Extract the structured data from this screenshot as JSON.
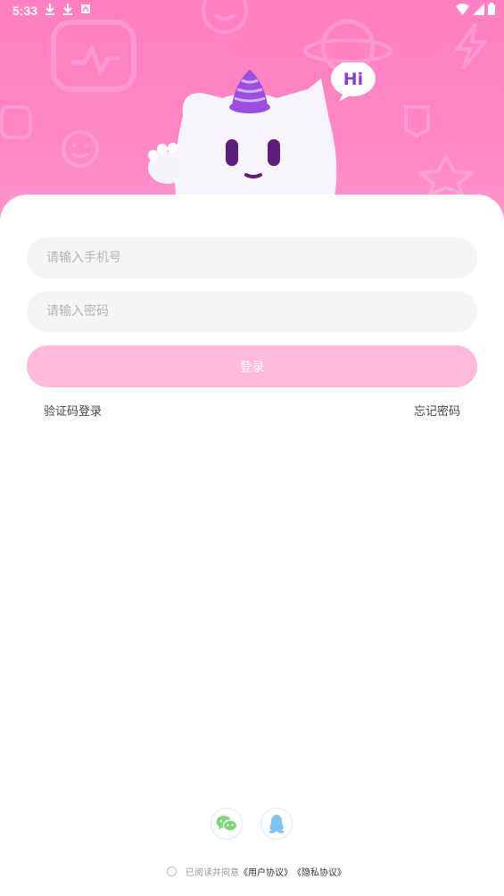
{
  "status": {
    "time": "5:33"
  },
  "login": {
    "phone_placeholder": "请输入手机号",
    "password_placeholder": "请输入密码",
    "button_label": "登录",
    "code_login_label": "验证码登录",
    "forgot_password_label": "忘记密码"
  },
  "mascot": {
    "bubble_text": "Hi"
  },
  "agreement": {
    "prefix": "已阅读并同意",
    "user_agreement": "《用户协议》",
    "privacy_policy": "《隐私协议》"
  },
  "social": {
    "icons": [
      "wechat-icon",
      "qq-icon"
    ]
  },
  "colors": {
    "hero_pink": "#ff86c4",
    "button_pink": "#ffbadb",
    "wechat_green": "#7ed67e",
    "qq_blue": "#7cc3ef"
  }
}
